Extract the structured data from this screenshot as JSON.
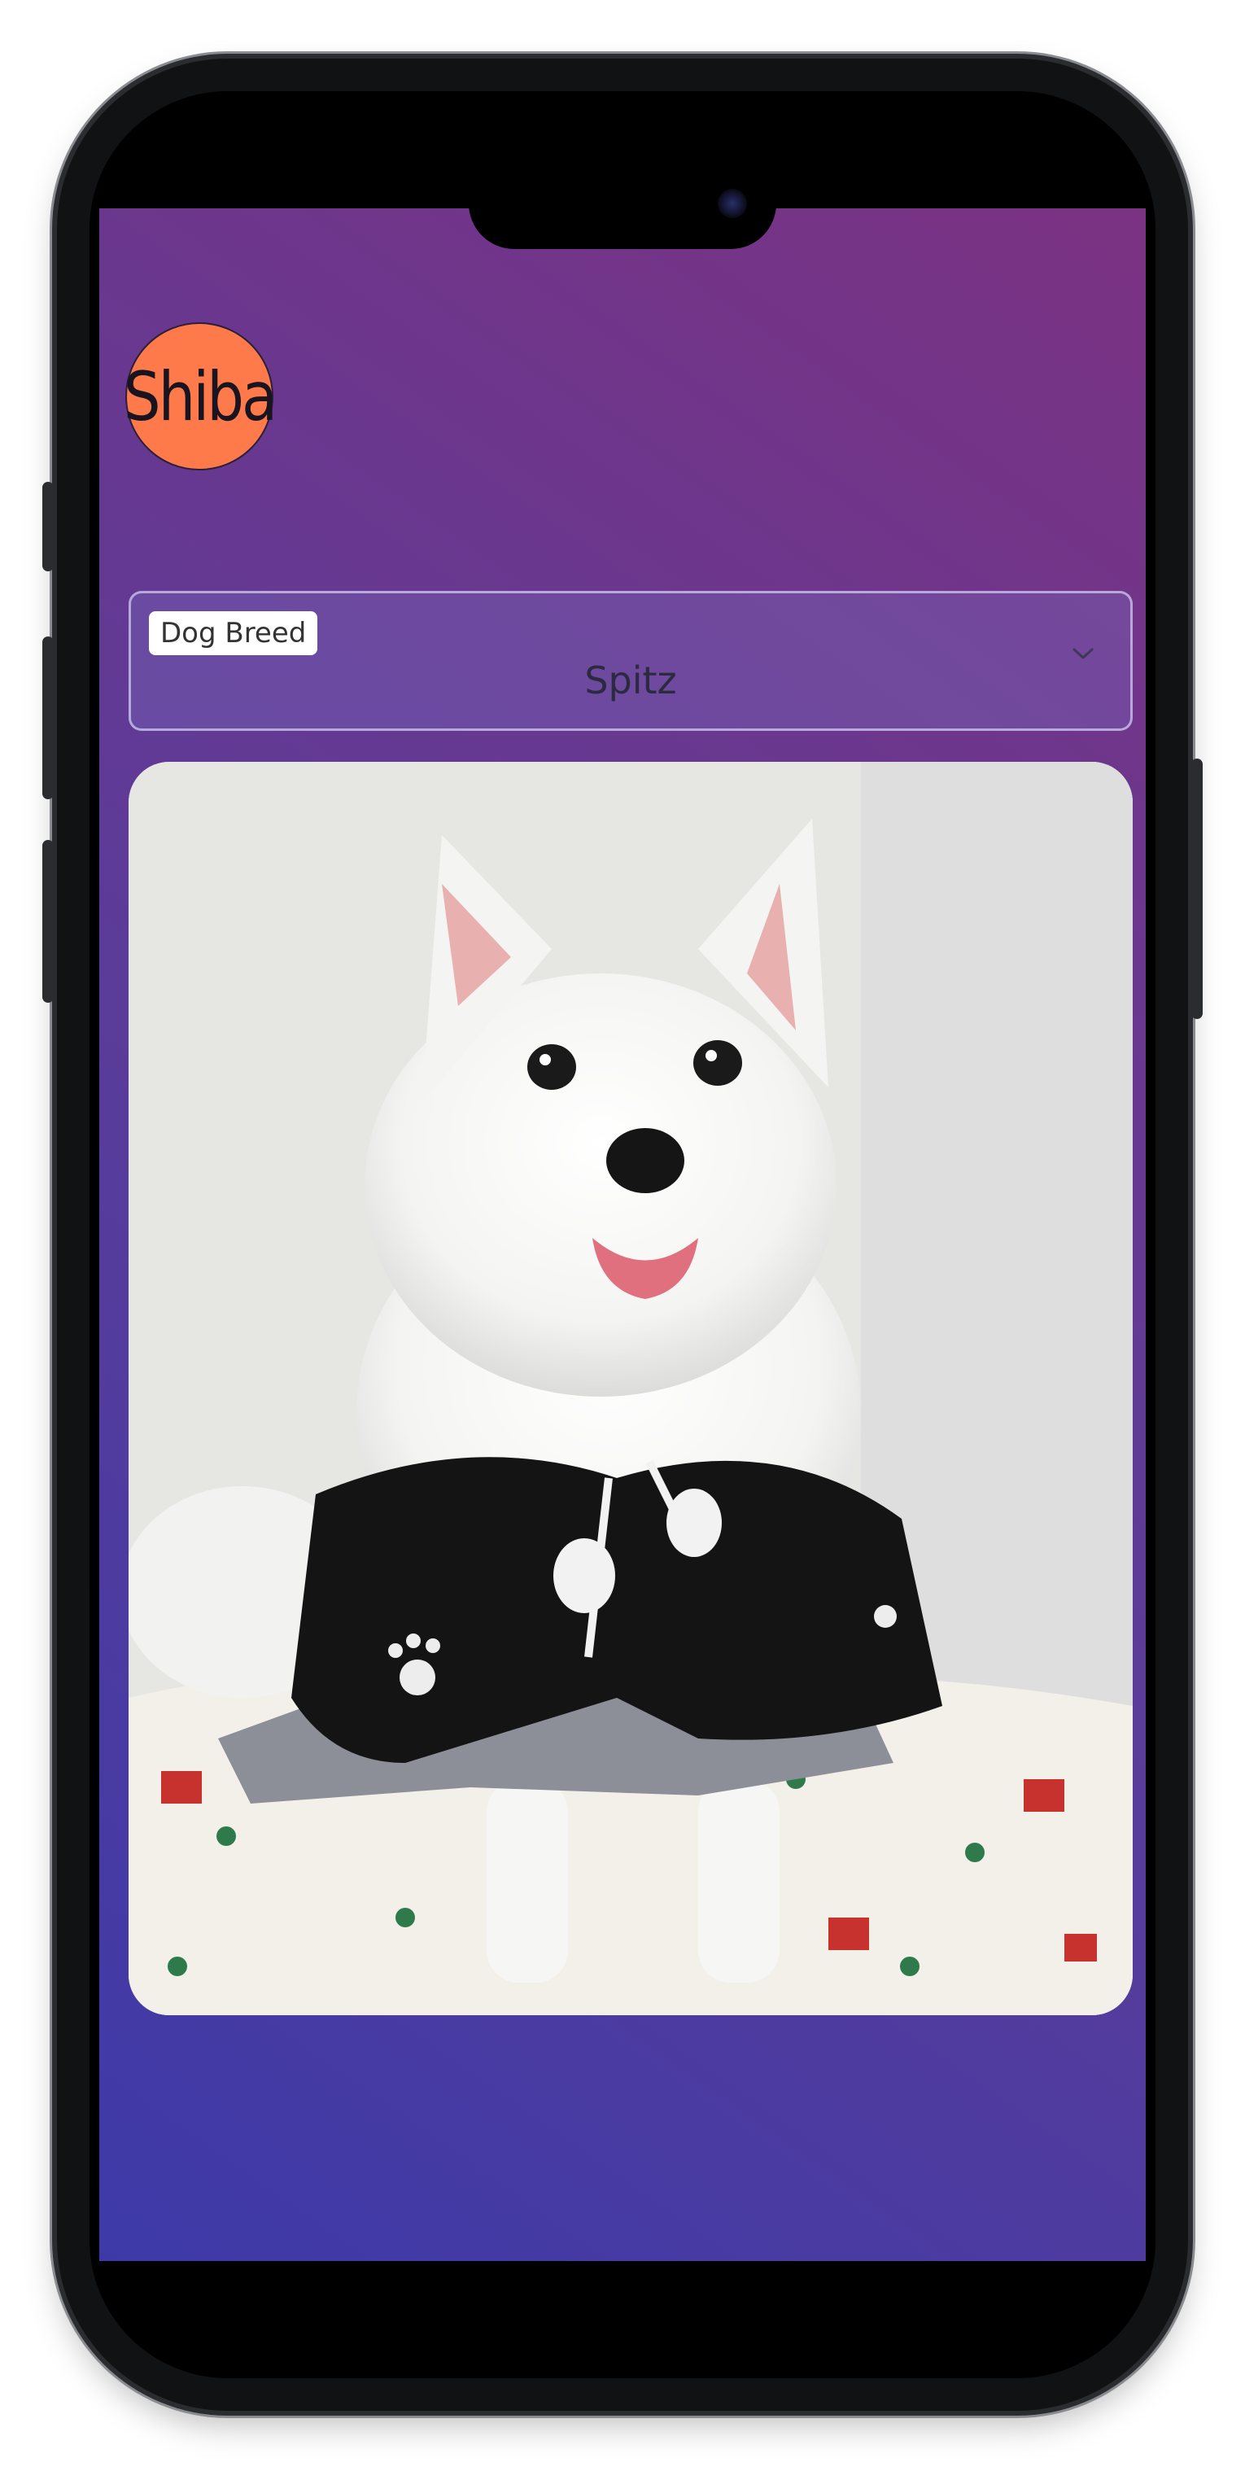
{
  "app": {
    "logo_text": "Shiba"
  },
  "breed_select": {
    "label": "Dog Breed",
    "value": "Spitz"
  },
  "photo": {
    "alt": "white dog in black outfit"
  }
}
